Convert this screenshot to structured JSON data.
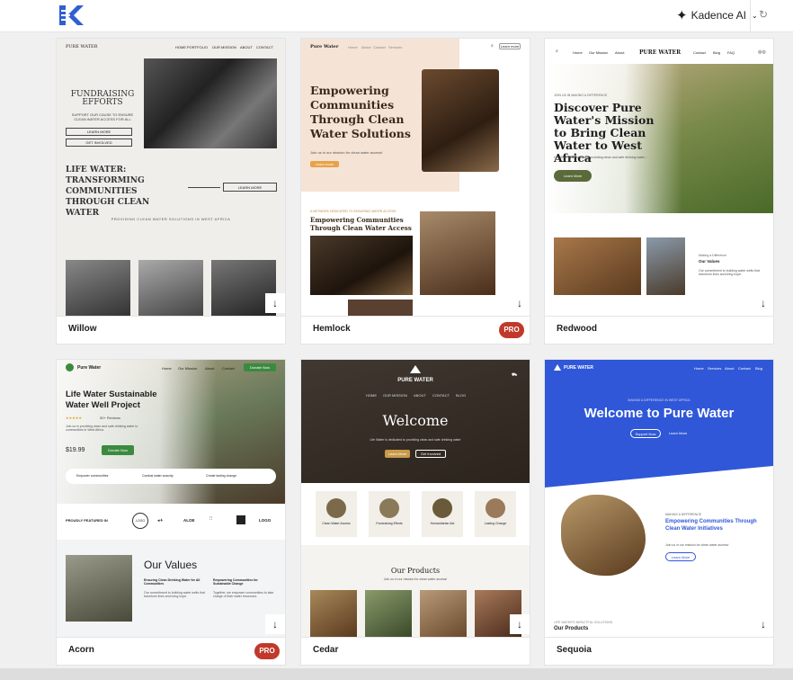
{
  "header": {
    "ai_button_label": "Kadence AI",
    "spark_icon": "✦",
    "chev": "⌄",
    "refresh_icon": "↻"
  },
  "arrow_glyph": "↓",
  "cards": [
    {
      "name": "Willow",
      "pro": false
    },
    {
      "name": "Hemlock",
      "pro": true,
      "badge": "PRO"
    },
    {
      "name": "Redwood",
      "pro": false
    },
    {
      "name": "Acorn",
      "pro": true,
      "badge": "PRO"
    },
    {
      "name": "Cedar",
      "pro": false
    },
    {
      "name": "Sequoia",
      "pro": false
    }
  ],
  "willow": {
    "brand": "PURE WATER",
    "nav": [
      "HOME",
      "PORTFOLIO",
      "OUR MISSION",
      "ABOUT",
      "CONTACT"
    ],
    "headline": "FUNDRAISING EFFORTS",
    "sub": "SUPPORT OUR CAUSE TO ENSURE CLEAN WATER ACCESS FOR ALL",
    "btn1": "LEARN MORE",
    "btn2": "GET INVOLVED",
    "hero2": "LIFE WATER: TRANSFORMING COMMUNITIES THROUGH CLEAN WATER",
    "btn3": "LEARN MORE",
    "tagline": "PROVIDING CLEAN WATER SOLUTIONS IN WEST AFRICA"
  },
  "hemlock": {
    "brand": "Pure Water",
    "nav": [
      "Home",
      "About",
      "Contact",
      "Services"
    ],
    "cta": "Learn more",
    "headline": "Empowering Communities Through Clean Water Solutions",
    "sub": "Join us in our mission for clean water access!",
    "btn": "Learn more",
    "kicker": "A NETWORK DEDICATED TO ENSURING WATER ACCESS",
    "headline2": "Empowering Communities Through Clean Water Access"
  },
  "redwood": {
    "nav_left": [
      "Home",
      "Our Mission",
      "About"
    ],
    "brand": "PURE WATER",
    "nav_right": [
      "Contact",
      "Blog",
      "FAQ"
    ],
    "kicker": "JOIN US IN MAKING A DIFFERENCE",
    "headline": "Discover Pure Water's Mission to Bring Clean Water to West Africa",
    "sub": "Life Water is dedicated to providing clean and safe drinking water...",
    "btn": "Learn More",
    "values_kicker": "Making a Difference",
    "values_title": "Our Values",
    "values_text": "Our commitment to building water wells that transform lives and bring hope."
  },
  "acorn": {
    "brand": "Pure Water",
    "nav": [
      "Home",
      "Our Mission",
      "About",
      "Contact"
    ],
    "cta": "Donate Now",
    "headline": "Life Water Sustainable Water Well Project",
    "stars": "★★★★★",
    "reviews": "50+ Reviews",
    "desc": "Join us in providing clean and safe drinking water to communities in West Africa.",
    "price": "$19.99",
    "btn": "Donate Now",
    "features": [
      "Empower communities",
      "Combat water scarcity",
      "Create lasting change"
    ],
    "featured": "PROUDLY FEATURED IN",
    "logos": [
      "LOGO",
      "",
      "ALOE",
      "",
      "",
      "LOGO"
    ],
    "values_title": "Our Values",
    "col1_title": "Ensuring Clean Drinking Water for All Communities",
    "col1_text": "Our commitment to building water wells that transform lives and bring hope.",
    "col2_title": "Empowering Communities for Sustainable Change",
    "col2_text": "Together, we empower communities to take charge of their water resources."
  },
  "cedar": {
    "brand": "PURE WATER",
    "nav": [
      "HOME",
      "OUR MISSION",
      "ABOUT",
      "CONTACT",
      "BLOG"
    ],
    "headline": "Welcome",
    "sub": "Life Water is dedicated to providing clean and safe drinking water",
    "btn1": "Learn More",
    "btn2": "Get Involved",
    "features": [
      "Clean Water Access",
      "Fundraising Efforts",
      "Humanitarian Aid",
      "Lasting Change"
    ],
    "products_title": "Our Products",
    "products_sub": "Join us in our mission for clean water access!"
  },
  "sequoia": {
    "brand": "PURE WATER",
    "nav": [
      "Home",
      "Services",
      "About",
      "Contact",
      "Blog"
    ],
    "kicker": "MAKING A DIFFERENCE IN WEST AFRICA",
    "headline": "Welcome to Pure Water",
    "btn1": "Support Now",
    "btn2": "Learn More",
    "kicker2": "MAKING A DIFFERENCE",
    "headline2": "Empowering Communities Through Clean Water Initiatives",
    "sub2": "Join us in our mission for clean water access!",
    "btn3": "Learn More",
    "kicker3": "LIFE WATER'S IMPACTFUL SOLUTIONS",
    "products": "Our Products"
  },
  "colors": {
    "pro_badge": "#c0392b",
    "sequoia_blue": "#2f57d8",
    "acorn_green": "#3b8a3f",
    "cedar_dark": "#3b3530",
    "hemlock_cream": "#f5e3d6"
  }
}
